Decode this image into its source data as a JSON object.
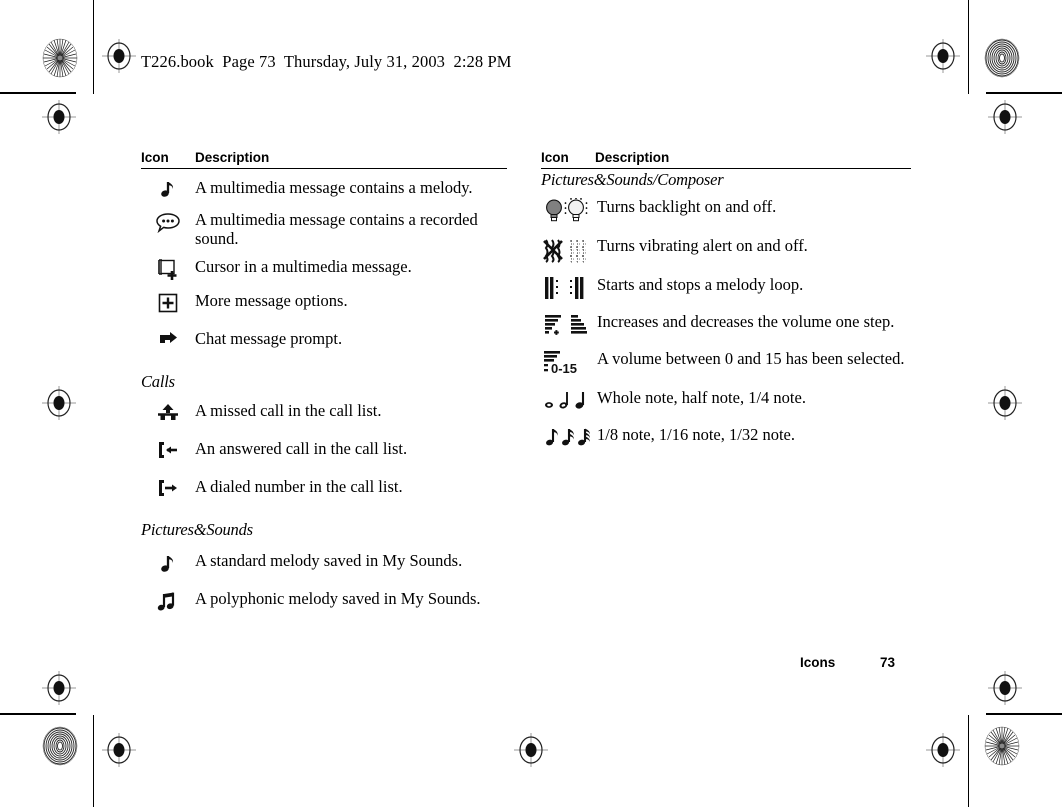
{
  "document": {
    "file_header": "T226.book  Page 73  Thursday, July 31, 2003  2:28 PM",
    "footer": {
      "chapter": "Icons",
      "page_number": "73"
    }
  },
  "left_column": {
    "header": {
      "icon": "Icon",
      "description": "Description"
    },
    "rows_messaging": [
      {
        "icon": "note-melody-icon",
        "description": "A multimedia message contains a melody."
      },
      {
        "icon": "speech-bubble-sound-icon",
        "description": "A multimedia message contains a recorded sound."
      },
      {
        "icon": "cursor-add-icon",
        "description": "Cursor in a multimedia message."
      },
      {
        "icon": "plus-box-icon",
        "description": "More message options."
      },
      {
        "icon": "chat-arrow-icon",
        "description": "Chat message prompt."
      }
    ],
    "section_calls": "Calls",
    "rows_calls": [
      {
        "icon": "missed-call-icon",
        "description": "A missed call in the call list."
      },
      {
        "icon": "answered-call-icon",
        "description": "An answered call in the call list."
      },
      {
        "icon": "dialed-call-icon",
        "description": "A dialed number in the call list."
      }
    ],
    "section_pictures_sounds": "Pictures&Sounds",
    "rows_pictures_sounds": [
      {
        "icon": "standard-melody-icon",
        "description": "A standard melody saved in My Sounds."
      },
      {
        "icon": "polyphonic-melody-icon",
        "description": "A polyphonic melody saved in My Sounds."
      }
    ]
  },
  "right_column": {
    "header": {
      "icon": "Icon",
      "description": "Description"
    },
    "section_composer": "Pictures&Sounds/Composer",
    "rows_composer": [
      {
        "icon": "backlight-on-off-icon",
        "description": "Turns backlight on and off."
      },
      {
        "icon": "vibrating-alert-on-off-icon",
        "description": "Turns vibrating alert on and off."
      },
      {
        "icon": "melody-loop-start-stop-icon",
        "description": "Starts and stops a melody loop."
      },
      {
        "icon": "volume-increase-decrease-icon",
        "description": "Increases and decreases the volume one step."
      },
      {
        "icon": "volume-level-icon",
        "description": "A volume between 0 and 15 has been selected."
      },
      {
        "icon": "whole-half-quarter-note-icon",
        "description": "Whole note, half note, 1/4 note."
      },
      {
        "icon": "eighth-sixteenth-thirtysecond-note-icon",
        "description": "1/8 note, 1/16 note, 1/32 note."
      }
    ],
    "volume_range_label": "0-15"
  },
  "print_marks": {
    "registration_mark": "registration-target-icon",
    "density_patch_radial": "radial-density-patch",
    "density_patch_concentric": "concentric-density-patch"
  },
  "colors": {
    "ink": "#000000",
    "paper": "#ffffff",
    "mark_gray": "#808080"
  }
}
